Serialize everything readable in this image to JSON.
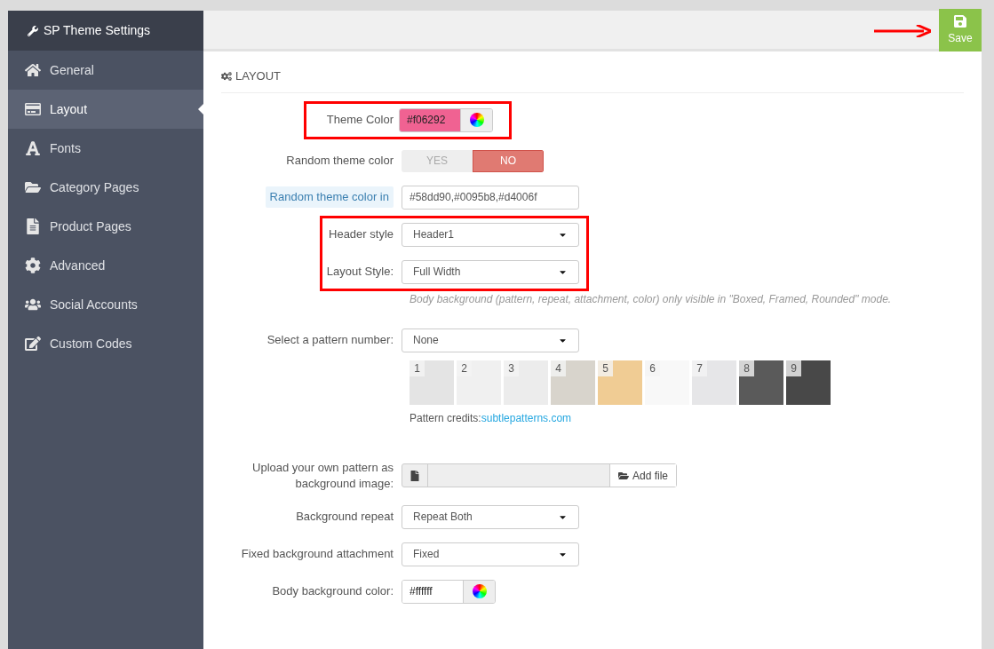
{
  "sidebar": {
    "title": "SP Theme Settings",
    "items": [
      {
        "label": "General",
        "selected": false
      },
      {
        "label": "Layout",
        "selected": true
      },
      {
        "label": "Fonts",
        "selected": false
      },
      {
        "label": "Category Pages",
        "selected": false
      },
      {
        "label": "Product Pages",
        "selected": false
      },
      {
        "label": "Advanced",
        "selected": false
      },
      {
        "label": "Social Accounts",
        "selected": false
      },
      {
        "label": "Custom Codes",
        "selected": false
      }
    ]
  },
  "toolbar": {
    "save_label": "Save"
  },
  "section": {
    "title": "LAYOUT"
  },
  "theme_color": {
    "label": "Theme Color",
    "value": "#f06292",
    "color": "#f06292"
  },
  "random_theme_color": {
    "label": "Random theme color",
    "options": [
      {
        "label": "YES",
        "selected": false
      },
      {
        "label": "NO",
        "selected": true
      }
    ]
  },
  "random_theme_color_in": {
    "label": "Random theme color in",
    "value": "#58dd90,#0095b8,#d4006f"
  },
  "header_style": {
    "label": "Header style",
    "value": "Header1"
  },
  "layout_style": {
    "label": "Layout Style:",
    "value": "Full Width",
    "hint": "Body background (pattern, repeat, attachment, color) only visible in \"Boxed, Framed, Rounded\" mode."
  },
  "pattern": {
    "label": "Select a pattern number:",
    "value": "None",
    "swatches": [
      {
        "number": "1",
        "color": "#e4e4e4"
      },
      {
        "number": "2",
        "color": "#f0f0f0"
      },
      {
        "number": "3",
        "color": "#ececec"
      },
      {
        "number": "4",
        "color": "#d8d4cc"
      },
      {
        "number": "5",
        "color": "#f0cc94"
      },
      {
        "number": "6",
        "color": "#f8f8f8"
      },
      {
        "number": "7",
        "color": "#e6e6e8"
      },
      {
        "number": "8",
        "color": "#5a5a5a"
      },
      {
        "number": "9",
        "color": "#484848"
      }
    ],
    "credits_prefix": "Pattern credits:",
    "credits_link": "subtlepatterns.com"
  },
  "upload": {
    "label": "Upload your own pattern as background image:",
    "button": "Add file"
  },
  "background_repeat": {
    "label": "Background repeat",
    "value": "Repeat Both"
  },
  "background_attachment": {
    "label": "Fixed background attachment",
    "value": "Fixed"
  },
  "body_color": {
    "label": "Body background color:",
    "value": "#ffffff",
    "color": "#ffffff"
  }
}
